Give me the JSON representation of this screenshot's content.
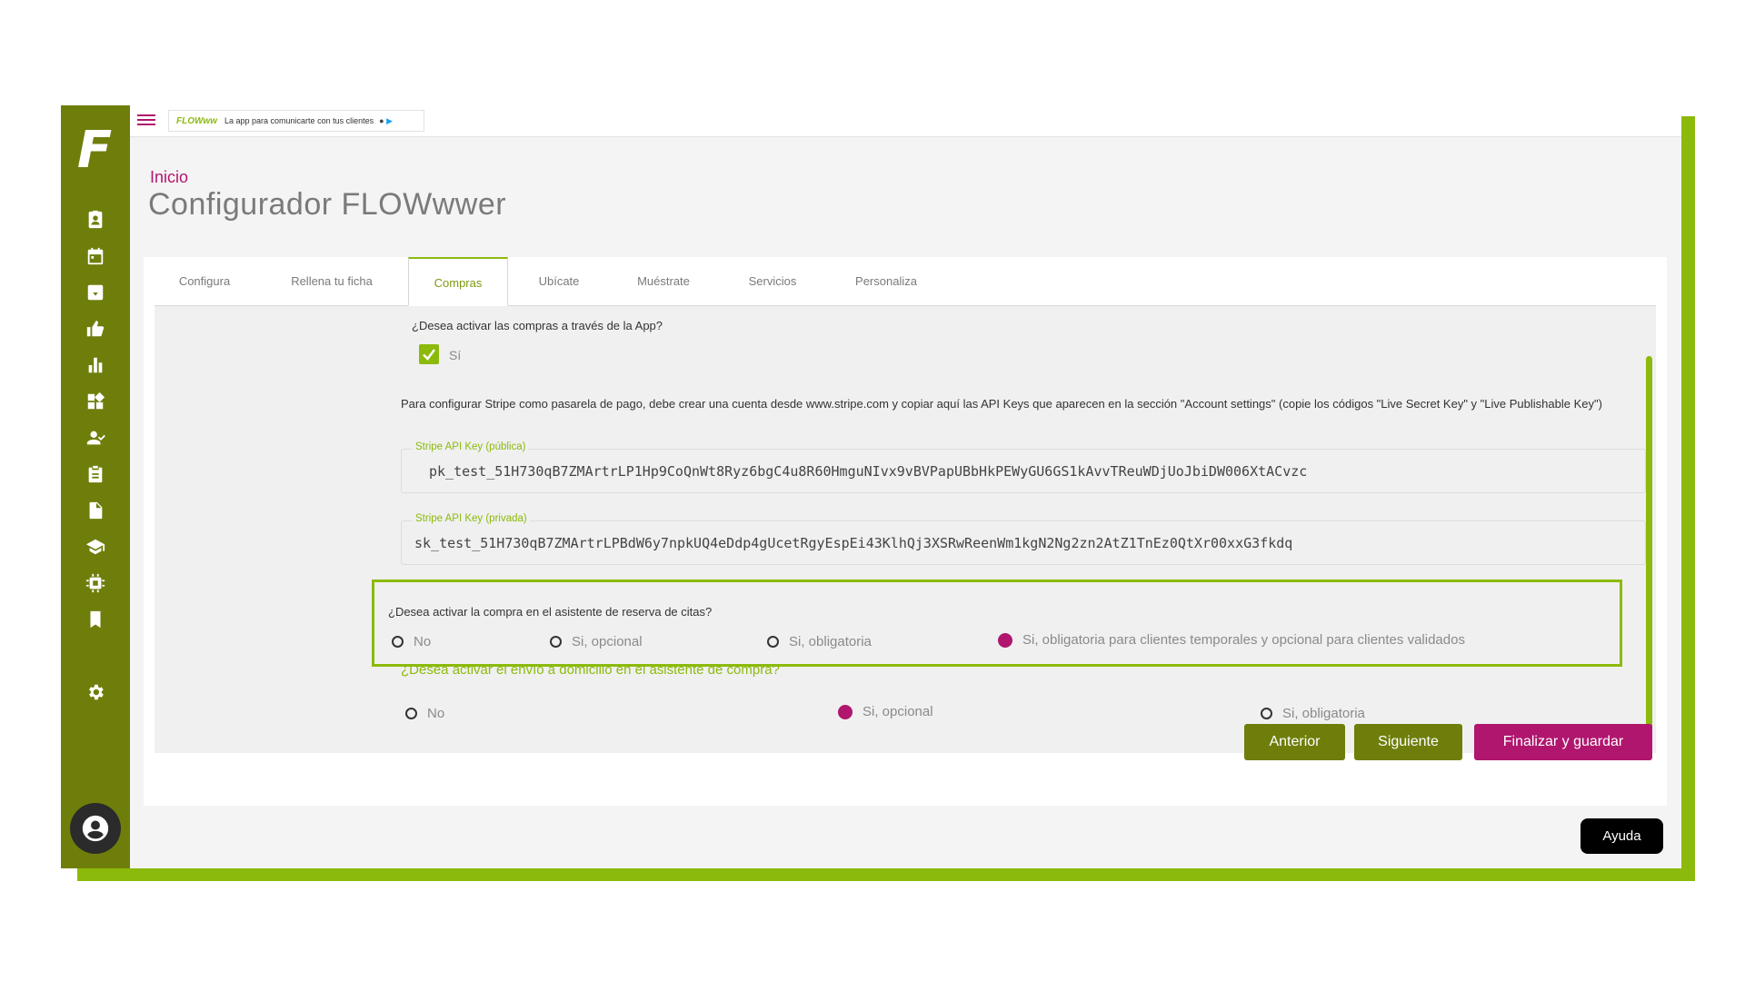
{
  "topbar": {
    "promo_brand": "FLOWww",
    "promo_text": "La app para comunicarte con tus clientes"
  },
  "breadcrumb": "Inicio",
  "page_title": "Configurador FLOWwwer",
  "tabs": [
    {
      "label": "Configura",
      "active": false
    },
    {
      "label": "Rellena tu ficha",
      "active": false
    },
    {
      "label": "Compras",
      "active": true
    },
    {
      "label": "Ubícate",
      "active": false
    },
    {
      "label": "Muéstrate",
      "active": false
    },
    {
      "label": "Servicios",
      "active": false
    },
    {
      "label": "Personaliza",
      "active": false
    }
  ],
  "purchases": {
    "question": "¿Desea activar las compras a través de la App?",
    "checkbox_label": "Sí",
    "checked": true,
    "info": "Para configurar Stripe como pasarela de pago, debe crear una cuenta desde www.stripe.com y copiar aquí las API Keys que aparecen en la sección \"Account settings\" (copie los códigos \"Live Secret Key\" y \"Live Publishable Key\")",
    "public_key": {
      "label": "Stripe API Key (pública)",
      "value": "pk_test_51H730qB7ZMArtrLP1Hp9CoQnWt8Ryz6bgC4u8R60HmguNIvx9vBVPapUBbHkPEWyGU6GS1kAvvTReuWDjUoJbiDW006XtACvzc"
    },
    "private_key": {
      "label": "Stripe API Key (privada)",
      "value": "sk_test_51H730qB7ZMArtrLPBdW6y7npkUQ4eDdp4gUcetRgyEspEi43KlhQj3XSRwReenWm1kgN2Ng2zn2AtZ1TnEz0QtXr00xxG3fkdq"
    }
  },
  "booking": {
    "question": "¿Desea activar la compra en el asistente de reserva de citas?",
    "options": [
      "No",
      "Si, opcional",
      "Si, obligatoria",
      "Si, obligatoria para clientes temporales y opcional para clientes validados"
    ],
    "selected": "Si, obligatoria para clientes temporales y opcional para clientes validados"
  },
  "delivery": {
    "question": "¿Desea activar el envío a domicilio en el asistente de compra?",
    "options": [
      "No",
      "Si, opcional",
      "Si, obligatoria"
    ],
    "selected": "Si, opcional"
  },
  "buttons": {
    "previous": "Anterior",
    "next": "Siguiente",
    "finish": "Finalizar y guardar"
  },
  "help": "Ayuda",
  "colors": {
    "sidebar": "#6f7e0b",
    "accent_green": "#8cba0c",
    "magenta": "#b0166e"
  },
  "sidebar_icons": [
    "contact-card-icon",
    "calendar-icon",
    "inbox-icon",
    "thumbs-up-icon",
    "bar-chart-icon",
    "widgets-icon",
    "user-check-icon",
    "clipboard-icon",
    "document-icon",
    "graduation-cap-icon",
    "chip-icon",
    "bookmark-icon",
    "gear-icon"
  ]
}
